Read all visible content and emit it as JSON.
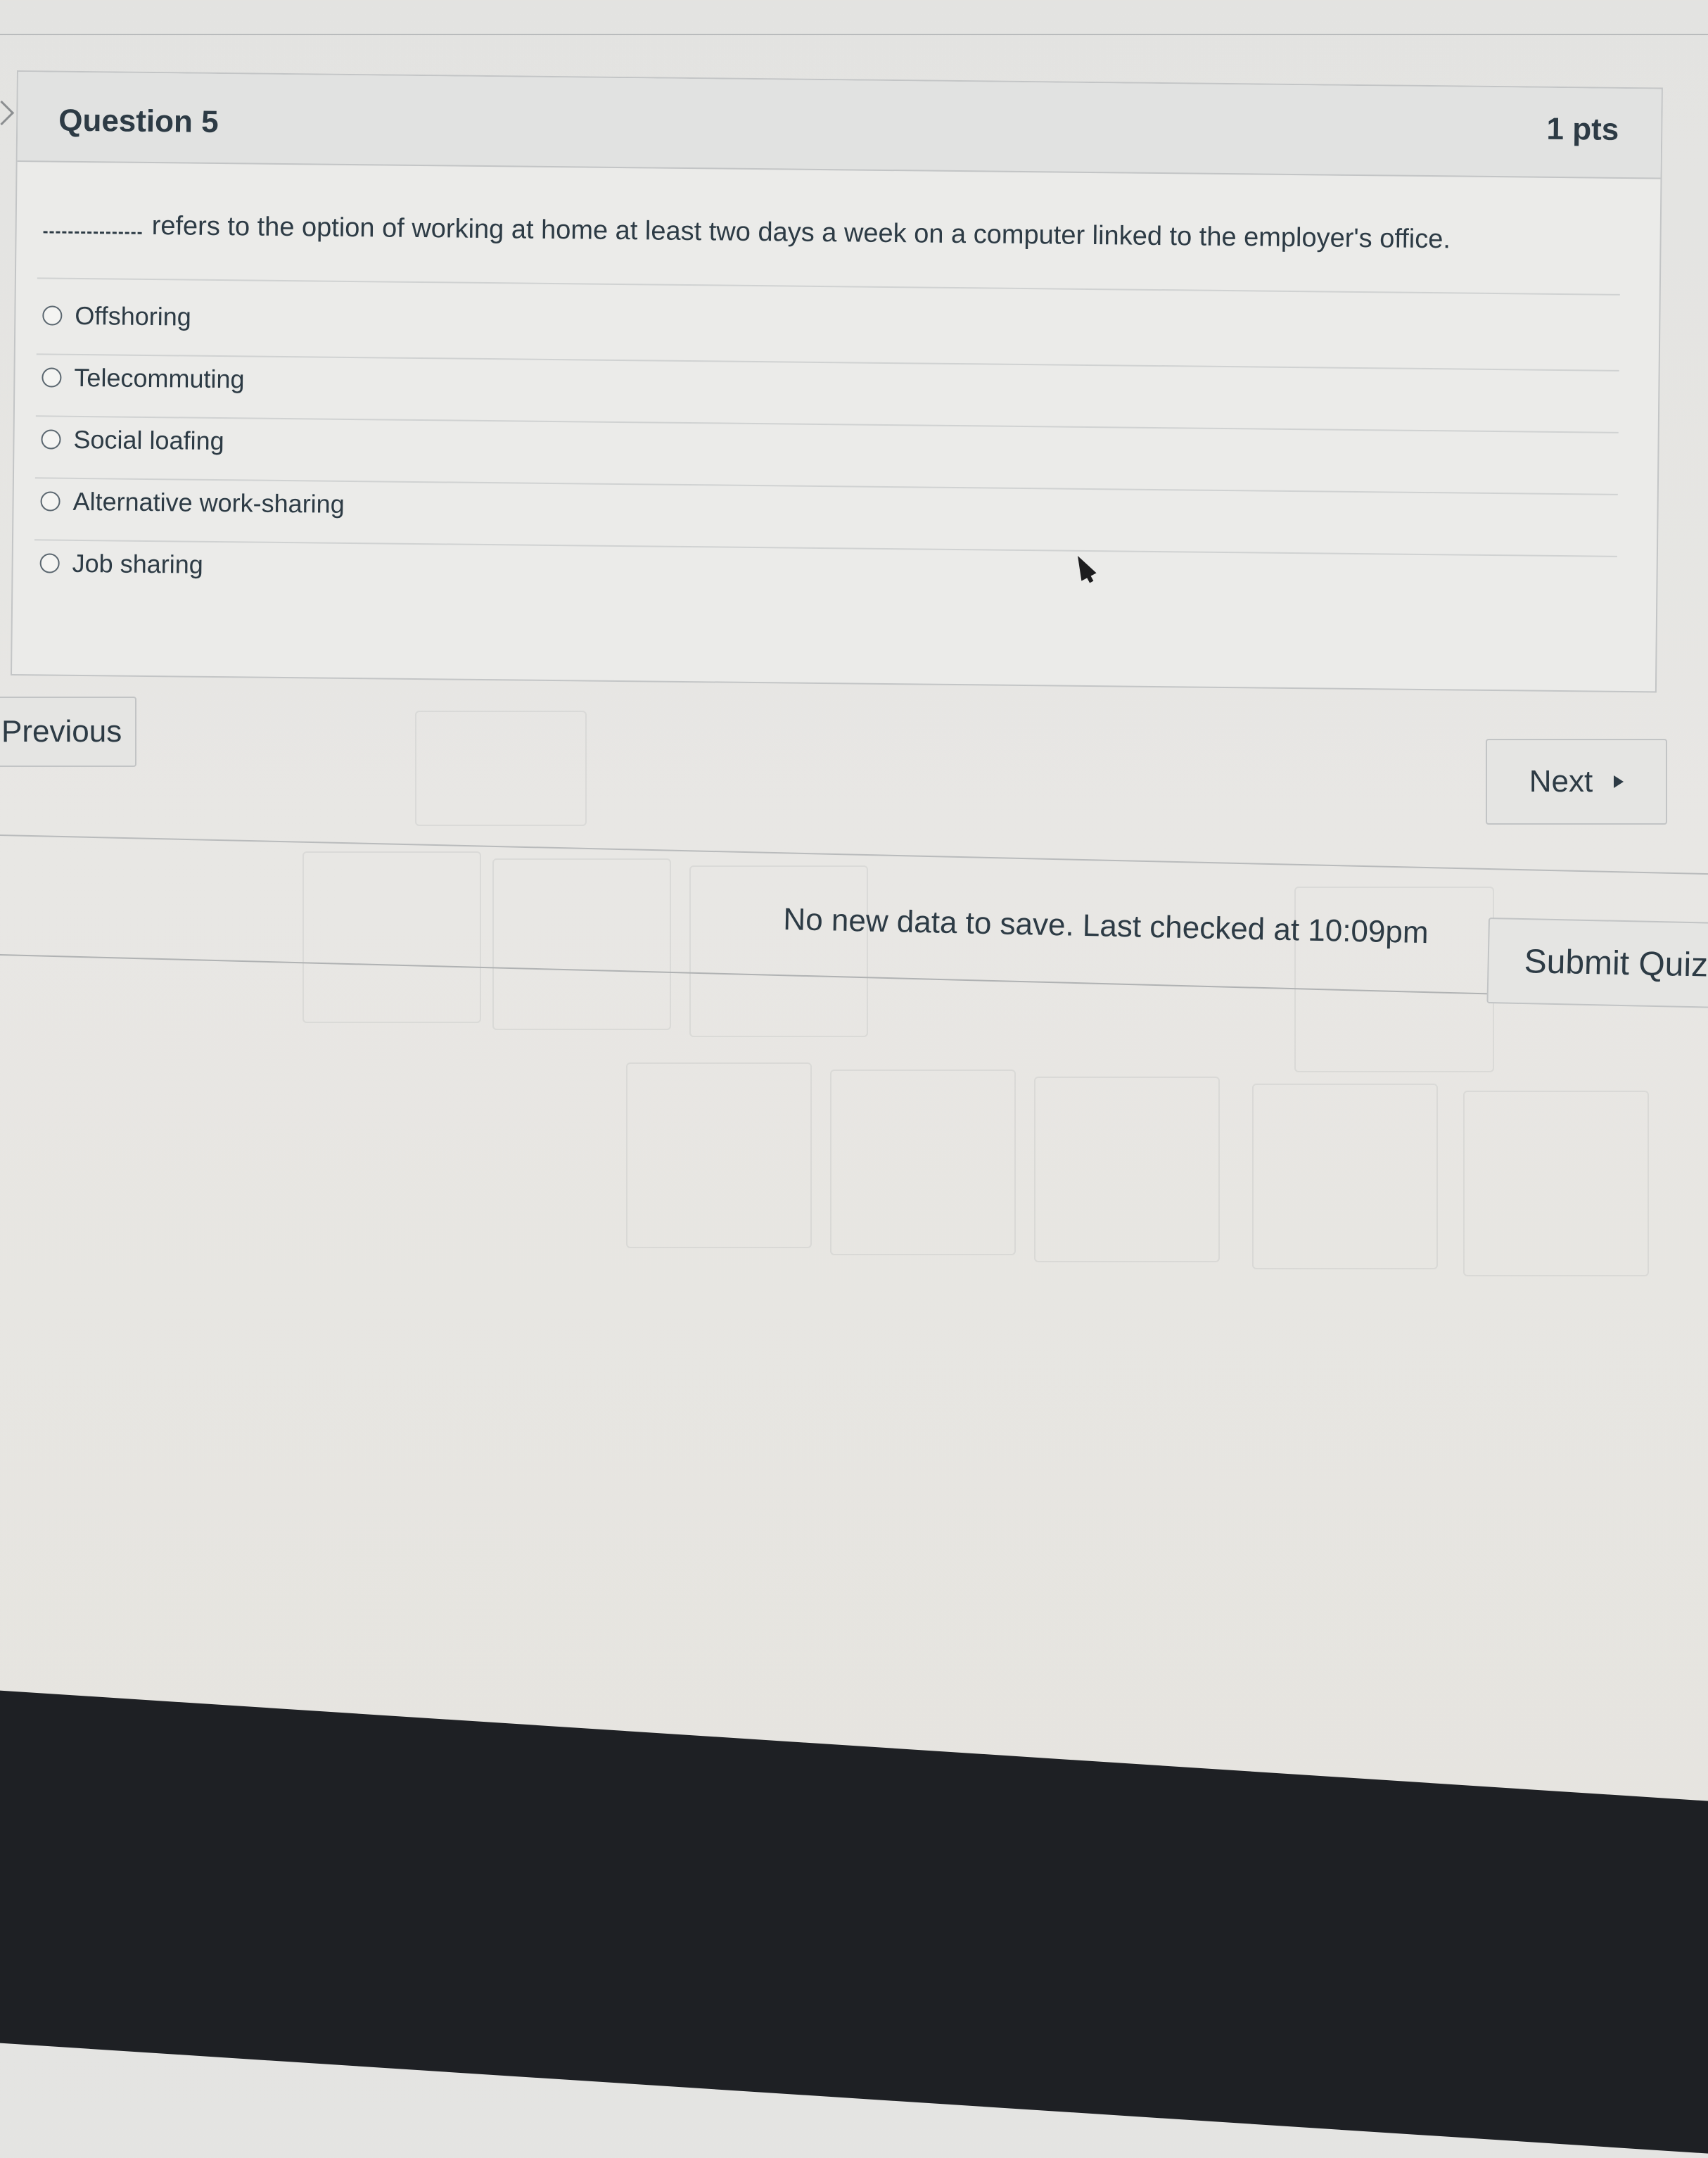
{
  "question": {
    "title": "Question 5",
    "points": "1 pts",
    "text": "refers to the option of working at home at least two days a week on a computer linked to the employer's office.",
    "answers": [
      {
        "label": "Offshoring"
      },
      {
        "label": "Telecommuting"
      },
      {
        "label": "Social loafing"
      },
      {
        "label": "Alternative work-sharing"
      },
      {
        "label": "Job sharing"
      }
    ]
  },
  "navigation": {
    "previous_label": "Previous",
    "next_label": "Next"
  },
  "footer": {
    "save_status": "No new data to save. Last checked at 10:09pm",
    "submit_label": "Submit Quiz"
  }
}
